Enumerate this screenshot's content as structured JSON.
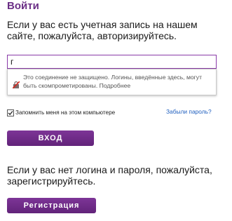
{
  "login": {
    "title": "Войти",
    "intro": "Если у вас есть учетная запись на нашем сайте, пожалуйста, авторизируйтесь.",
    "username_value": "г"
  },
  "warning": {
    "icon": "insecure-lock-icon",
    "text": "Это соединение не защищено. Логины, введённые здесь, могут быть скомпрометированы. Подробнее"
  },
  "remember": {
    "label": "Запомнить меня на этом компьютере",
    "checked": true
  },
  "forgot_link": "Забыли пароль?",
  "buttons": {
    "login": "ВХОД",
    "register": "Регистрация"
  },
  "register_prompt": "Если у вас нет логина и пароля, пожалуйста, зарегистрируйтесь.",
  "colors": {
    "accent": "#6b2f86",
    "button": "#6e2b88",
    "link": "#1f5fbf"
  }
}
